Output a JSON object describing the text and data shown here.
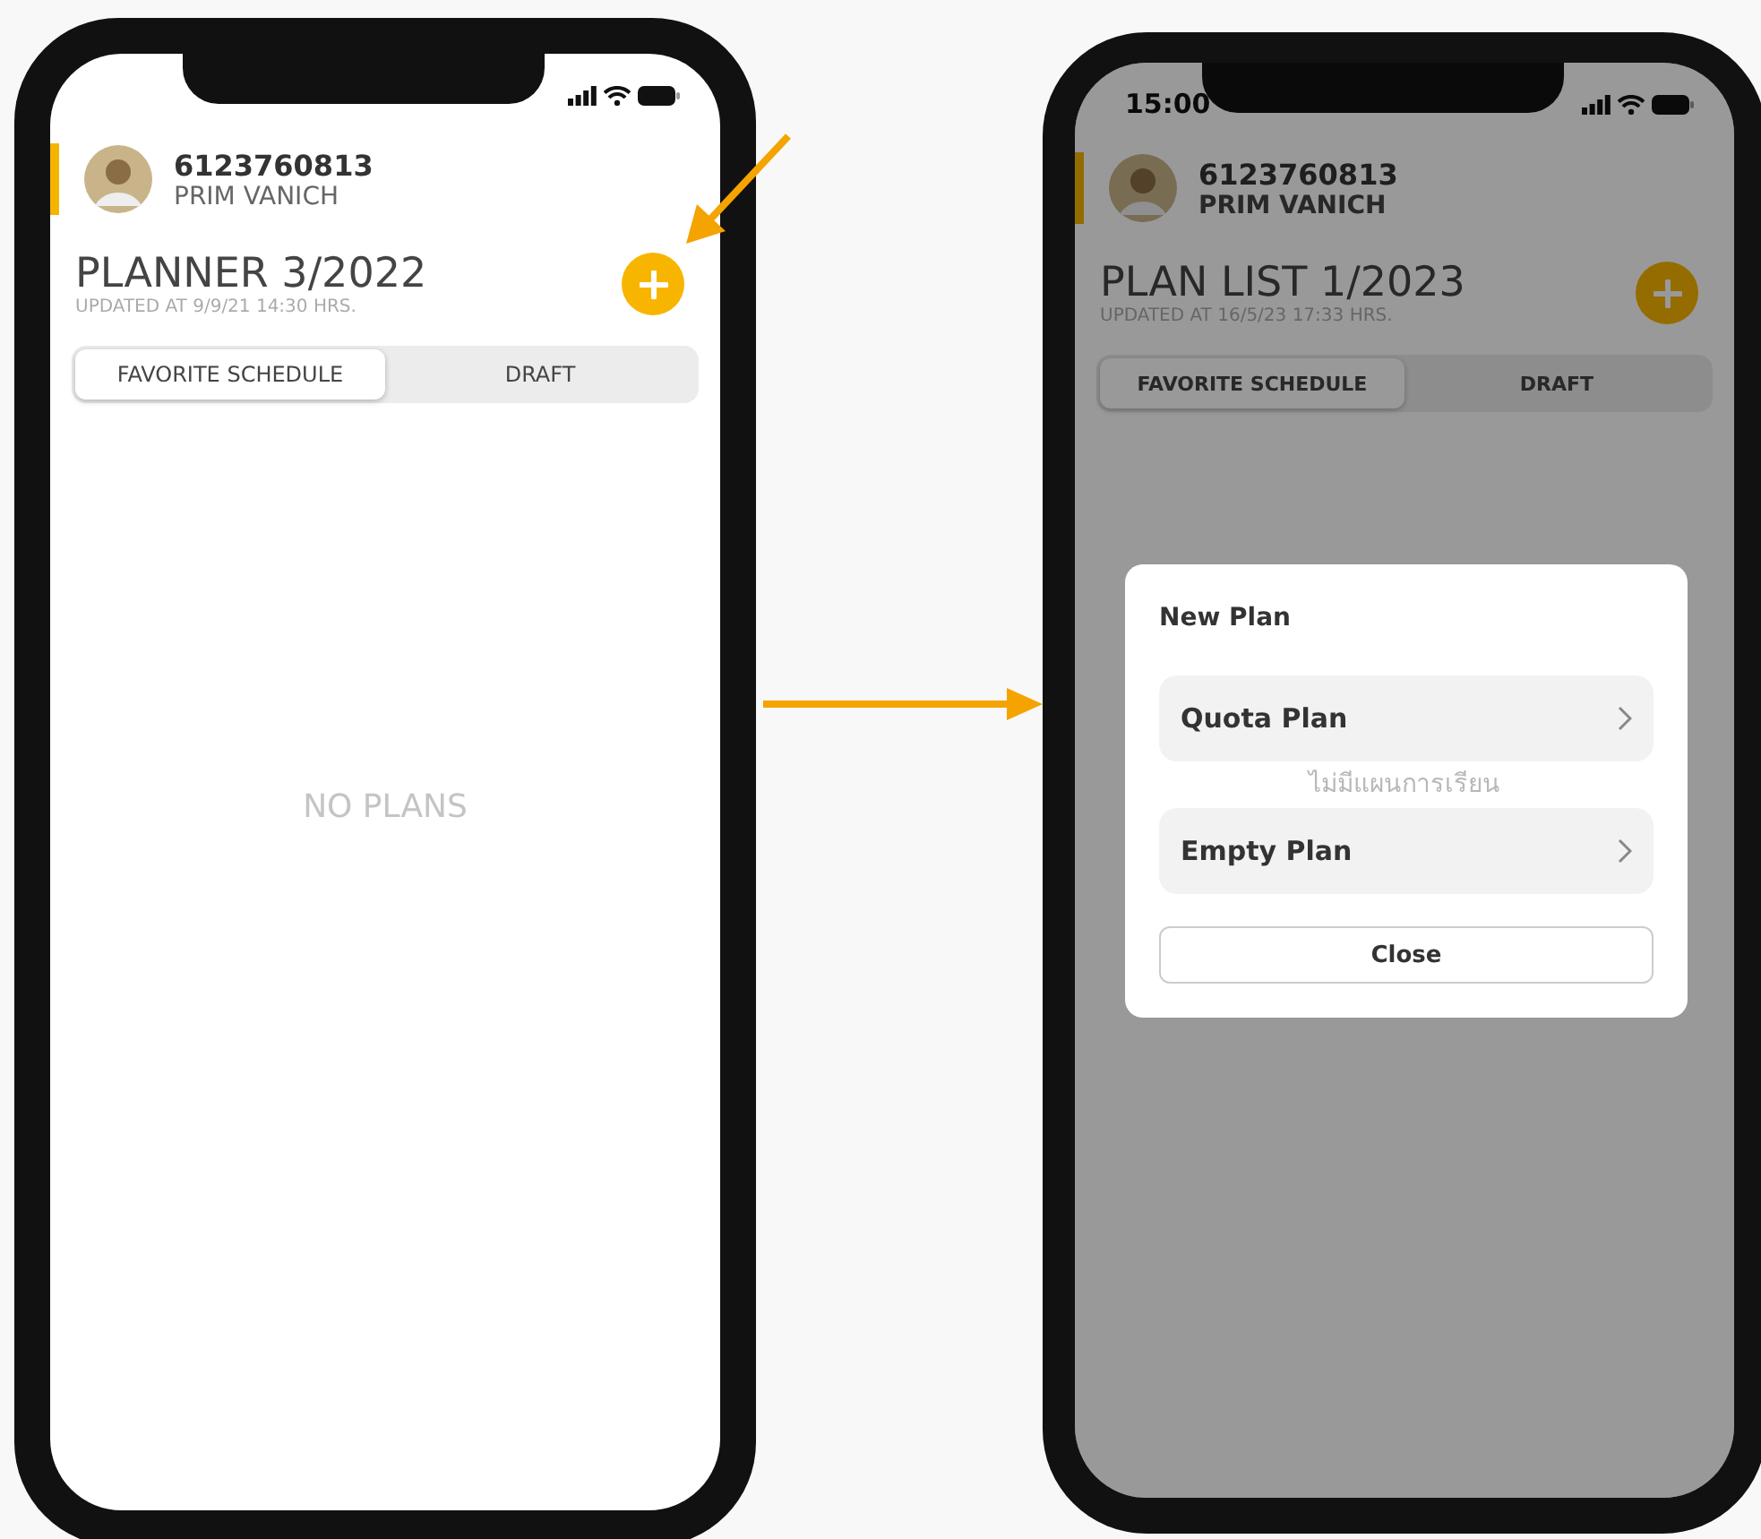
{
  "screens": [
    {
      "user": {
        "id": "6123760813",
        "name": "PRIM VANICH"
      },
      "title": "PLANNER 3/2022",
      "updated": "UPDATED AT 9/9/21 14:30 HRS.",
      "tabs": [
        {
          "label": "FAVORITE SCHEDULE",
          "selected": true
        },
        {
          "label": "DRAFT",
          "selected": false
        }
      ],
      "empty_text": "NO PLANS",
      "dimmed": false
    },
    {
      "status_time": "15:00",
      "user": {
        "id": "6123760813",
        "name": "PRIM VANICH"
      },
      "title": "PLAN LIST 1/2023",
      "updated": "UPDATED AT 16/5/23 17:33 HRS.",
      "tabs": [
        {
          "label": "FAVORITE SCHEDULE",
          "selected": true
        },
        {
          "label": "DRAFT",
          "selected": false
        }
      ],
      "empty_text": "ไม่มีแผนการเรียน",
      "dimmed": true,
      "dialog": {
        "title": "New Plan",
        "options": [
          "Quota Plan",
          "Empty Plan"
        ],
        "close": "Close"
      }
    }
  ]
}
